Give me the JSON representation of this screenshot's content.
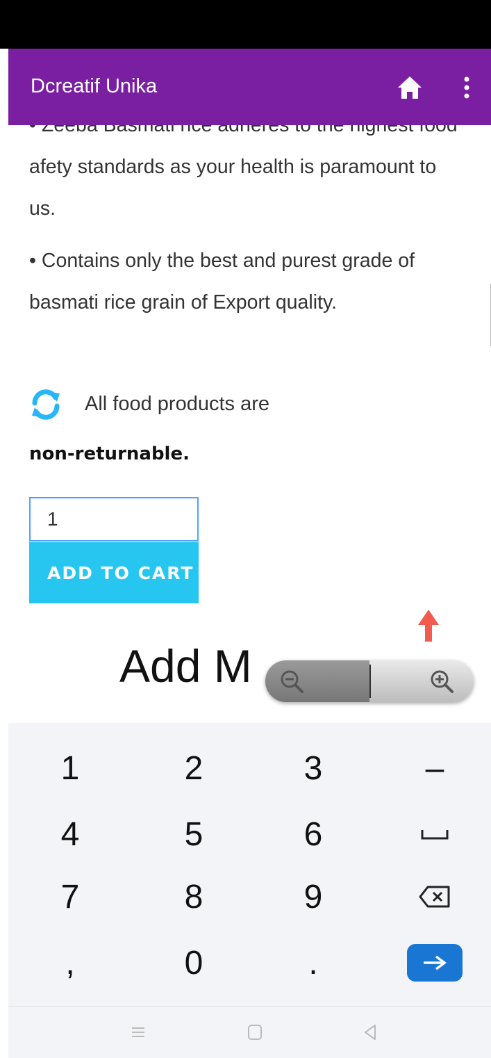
{
  "app": {
    "title": "Dcreatif Unika"
  },
  "content": {
    "bullet1": "•   Zeeba Basmati rice adheres to the highest food afety standards as your health is paramount to us.",
    "bullet2": "•   Contains only the best and purest grade of basmati rice grain of Export quality.",
    "return_text": "All food products are",
    "return_bold": "non-returnable.",
    "quantity_value": "1",
    "add_to_cart": "ADD TO CART",
    "add_heading": "Add M"
  },
  "keyboard": {
    "keys": [
      "1",
      "2",
      "3",
      "–",
      "4",
      "5",
      "6",
      "␣",
      "7",
      "8",
      "9",
      "⌫",
      ",",
      "0",
      ".",
      "→"
    ]
  },
  "colors": {
    "appbar": "#7b1fa2",
    "cart_button": "#26c6f0",
    "enter_key": "#1976d2",
    "scroll_arrow": "#f05a4f"
  }
}
